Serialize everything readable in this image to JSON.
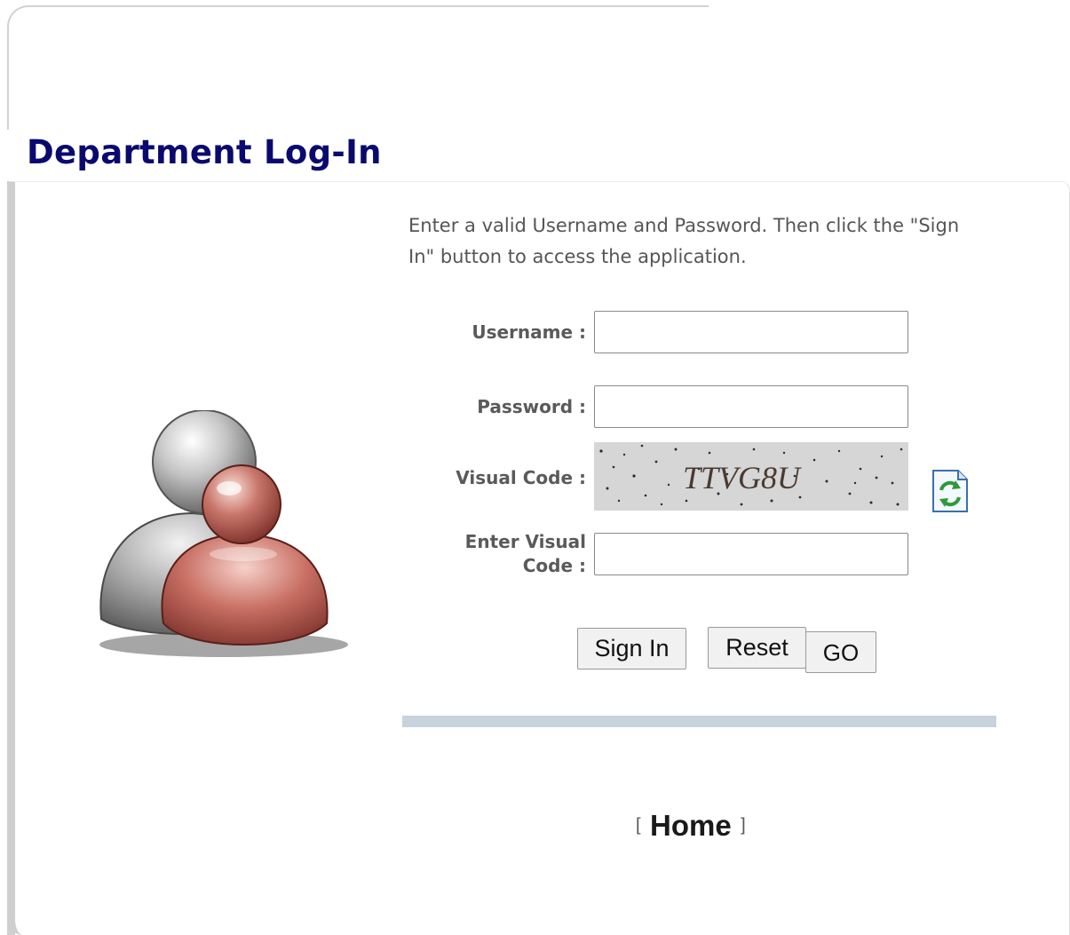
{
  "page": {
    "title": "Department Log-In",
    "instructions": "Enter a valid Username and Password. Then click the \"Sign In\" button to access the application."
  },
  "form": {
    "username_label": "Username :",
    "username_value": "",
    "password_label": "Password :",
    "password_value": "",
    "visual_code_label": "Visual Code :",
    "captcha_text": "TTVG8U",
    "enter_visual_code_label_line1": "Enter Visual",
    "enter_visual_code_label_line2": "Code :",
    "enter_visual_code_value": ""
  },
  "buttons": {
    "sign_in": "Sign In",
    "reset": "Reset",
    "go": "GO"
  },
  "footer": {
    "bracket_open": "[",
    "home_link": "Home",
    "bracket_close": "]"
  },
  "icons": {
    "users": "users-icon",
    "refresh": "refresh-captcha-icon"
  },
  "colors": {
    "title": "#0a0a6e",
    "divider": "#c8d2dc",
    "panel_border": "#cfcfcf"
  }
}
